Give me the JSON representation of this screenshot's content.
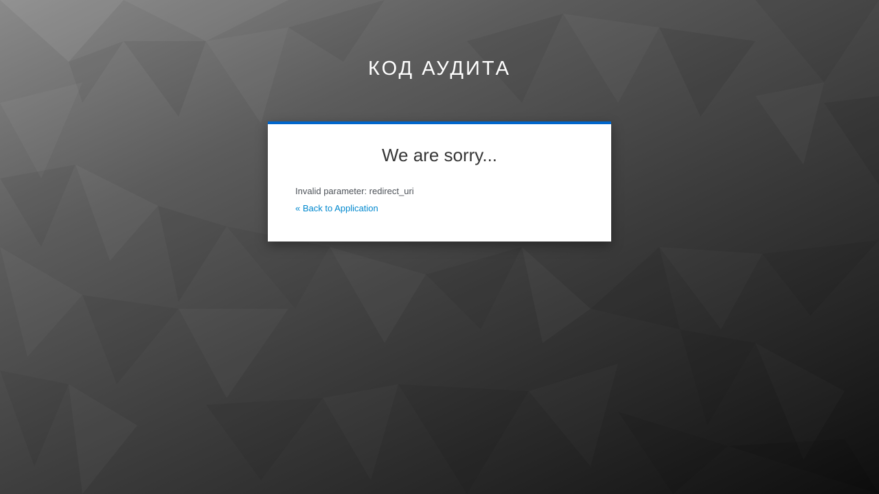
{
  "header": {
    "realm_name": "КОД АУДИТА"
  },
  "error_card": {
    "title": "We are sorry...",
    "message": "Invalid parameter: redirect_uri",
    "back_link": "« Back to Application"
  },
  "colors": {
    "accent": "#0066cc",
    "link": "#0088ce",
    "card_background": "#ffffff"
  }
}
